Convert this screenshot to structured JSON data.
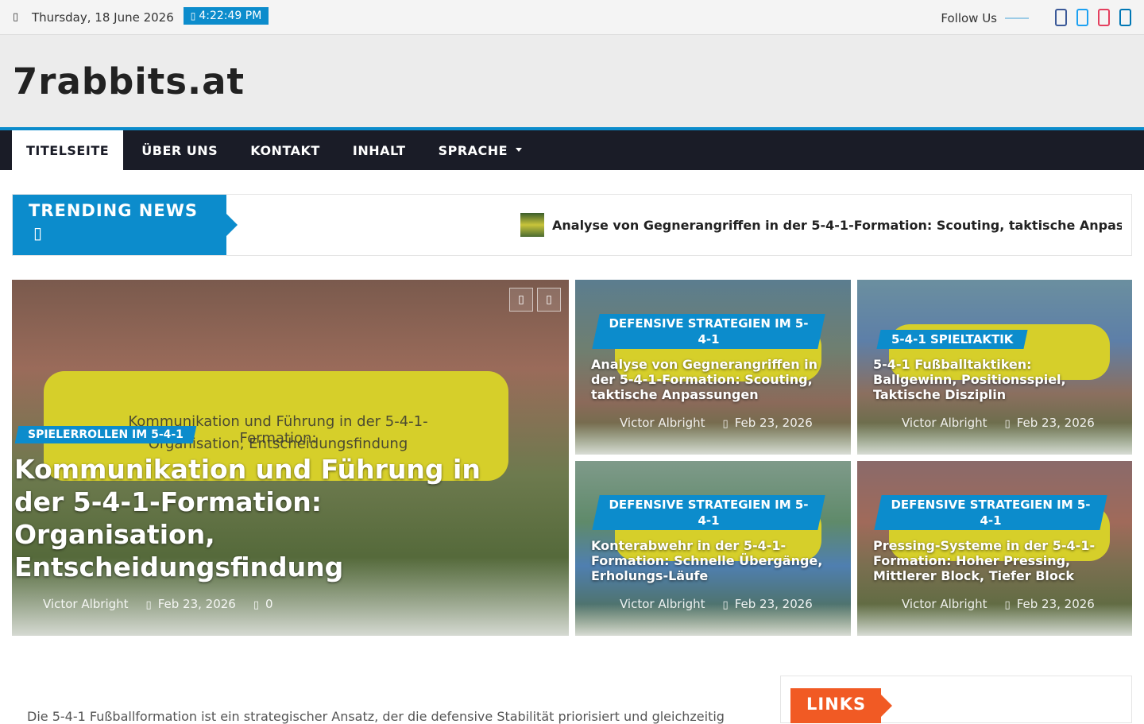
{
  "topbar": {
    "date": "Thursday, 18 June 2026",
    "time": "4:22:49 PM",
    "follow_label": "Follow Us"
  },
  "social": [
    {
      "name": "facebook-icon",
      "color": "#3b5998"
    },
    {
      "name": "twitter-icon",
      "color": "#1da1f2"
    },
    {
      "name": "instagram-icon",
      "color": "#e4405f"
    },
    {
      "name": "linkedin-icon",
      "color": "#0077b5"
    }
  ],
  "site": {
    "title": "7rabbits.at"
  },
  "nav": {
    "items": [
      "TITELSEITE",
      "ÜBER UNS",
      "KONTAKT",
      "INHALT",
      "SPRACHE"
    ]
  },
  "trending": {
    "label": "TRENDING NEWS",
    "headline": "Analyse von Gegnerangriffen in der 5-4-1-Formation: Scouting, taktische Anpas"
  },
  "featured": {
    "category": "SPIELERROLLEN IM 5-4-1",
    "title": "Kommunikation und Führung in der 5-4-1-Formation: Organisation, Entscheidungsfindung",
    "image_text_1": "Kommunikation und Führung in der 5-4-1-Formation:",
    "image_text_2": "Organisation, Entscheidungsfindung",
    "author": "Victor Albright",
    "date": "Feb 23, 2026",
    "comments": "0"
  },
  "cards": [
    {
      "category": "DEFENSIVE STRATEGIEN IM 5-4-1",
      "title": "Analyse von Gegnerangriffen in der 5-4-1-Formation: Scouting, taktische Anpassungen",
      "author": "Victor Albright",
      "date": "Feb 23, 2026"
    },
    {
      "category": "5-4-1 SPIELTAKTIK",
      "title": "5-4-1 Fußballtaktiken: Ballgewinn, Positionsspiel, Taktische Disziplin",
      "author": "Victor Albright",
      "date": "Feb 23, 2026"
    },
    {
      "category": "DEFENSIVE STRATEGIEN IM 5-4-1",
      "title": "Konterabwehr in der 5-4-1-Formation: Schnelle Übergänge, Erholungs-Läufe",
      "author": "Victor Albright",
      "date": "Feb 23, 2026"
    },
    {
      "category": "DEFENSIVE STRATEGIEN IM 5-4-1",
      "title": "Pressing-Systeme in der 5-4-1-Formation: Hoher Pressing, Mittlerer Block, Tiefer Block",
      "author": "Victor Albright",
      "date": "Feb 23, 2026"
    }
  ],
  "sidebar": {
    "links_label": "LINKS"
  },
  "article": {
    "excerpt": "Die 5-4-1 Fußballformation ist ein strategischer Ansatz, der die defensive Stabilität priorisiert und gleichzeitig"
  },
  "colors": {
    "accent": "#0c8ccc",
    "nav_bg": "#1a1c27",
    "links": "#f15a24"
  }
}
